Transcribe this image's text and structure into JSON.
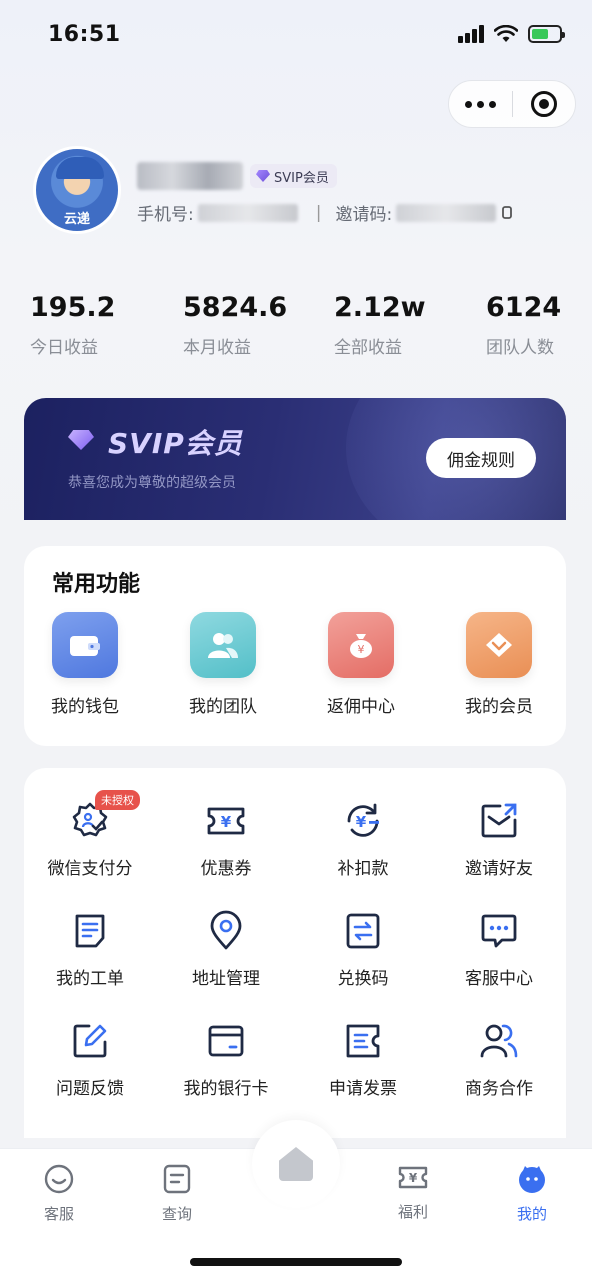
{
  "status_bar": {
    "time": "16:51"
  },
  "profile": {
    "badge": "SVIP会员",
    "avatar_text": "云递",
    "phone_label": "手机号:",
    "invite_label": "邀请码:"
  },
  "stats": [
    {
      "value": "195.2",
      "label": "今日收益"
    },
    {
      "value": "5824.6",
      "label": "本月收益"
    },
    {
      "value": "2.12w",
      "label": "全部收益"
    },
    {
      "value": "6124",
      "label": "团队人数"
    }
  ],
  "banner": {
    "title": "SVIP会员",
    "subtitle": "恭喜您成为尊敬的超级会员",
    "button": "佣金规则"
  },
  "common": {
    "heading": "常用功能",
    "items": [
      {
        "label": "我的钱包",
        "icon": "wallet-icon"
      },
      {
        "label": "我的团队",
        "icon": "team-icon"
      },
      {
        "label": "返佣中心",
        "icon": "money-bag-icon"
      },
      {
        "label": "我的会员",
        "icon": "member-diamond-icon"
      }
    ]
  },
  "tools": {
    "unauthorized_badge": "未授权",
    "items": [
      {
        "label": "微信支付分",
        "icon": "wechat-pay-score-icon"
      },
      {
        "label": "优惠券",
        "icon": "coupon-icon"
      },
      {
        "label": "补扣款",
        "icon": "refund-icon"
      },
      {
        "label": "邀请好友",
        "icon": "invite-icon"
      },
      {
        "label": "我的工单",
        "icon": "work-order-icon"
      },
      {
        "label": "地址管理",
        "icon": "location-icon"
      },
      {
        "label": "兑换码",
        "icon": "exchange-code-icon"
      },
      {
        "label": "客服中心",
        "icon": "chat-icon"
      },
      {
        "label": "问题反馈",
        "icon": "edit-icon"
      },
      {
        "label": "我的银行卡",
        "icon": "bank-card-icon"
      },
      {
        "label": "申请发票",
        "icon": "invoice-icon"
      },
      {
        "label": "商务合作",
        "icon": "business-icon"
      }
    ]
  },
  "tabbar": {
    "items": [
      {
        "label": "客服",
        "icon": "customer-service-icon"
      },
      {
        "label": "查询",
        "icon": "query-icon"
      },
      {
        "label": "福利",
        "icon": "welfare-icon"
      },
      {
        "label": "我的",
        "icon": "profile-icon",
        "active": true
      }
    ]
  },
  "colors": {
    "accent": "#3a6ff0",
    "badge_red": "#e7524b",
    "banner_dark": "#1c2160"
  }
}
